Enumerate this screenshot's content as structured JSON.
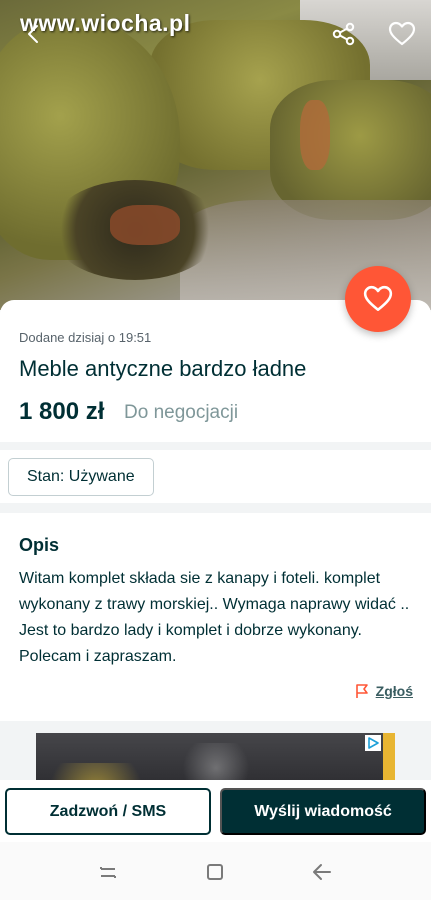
{
  "watermark": "www.wiocha.pl",
  "header": {
    "back_icon": "back-arrow-icon",
    "share_icon": "share-icon",
    "favorite_icon": "heart-outline-icon"
  },
  "fab": {
    "icon": "heart-outline-icon",
    "color": "#ff5636"
  },
  "listing": {
    "date": "Dodane dzisiaj o 19:51",
    "title": "Meble antyczne bardzo ładne",
    "price": "1 800 zł",
    "negotiable": "Do negocjacji"
  },
  "params": {
    "condition": "Stan: Używane"
  },
  "description": {
    "heading": "Opis",
    "text": "Witam komplet składa sie z kanapy i foteli. komplet wykonany z trawy morskiej.. Wymaga naprawy widać .. Jest to bardzo lady i komplet i dobrze wykonany. Polecam i zapraszam.",
    "report": "Zgłoś"
  },
  "actions": {
    "call": "Zadzwoń / SMS",
    "message": "Wyślij wiadomość"
  },
  "colors": {
    "primary": "#002f34",
    "accent": "#ff5636",
    "muted": "#7f9799"
  },
  "system_nav": {
    "recents": "recents-icon",
    "home": "home-icon",
    "back": "back-icon"
  }
}
